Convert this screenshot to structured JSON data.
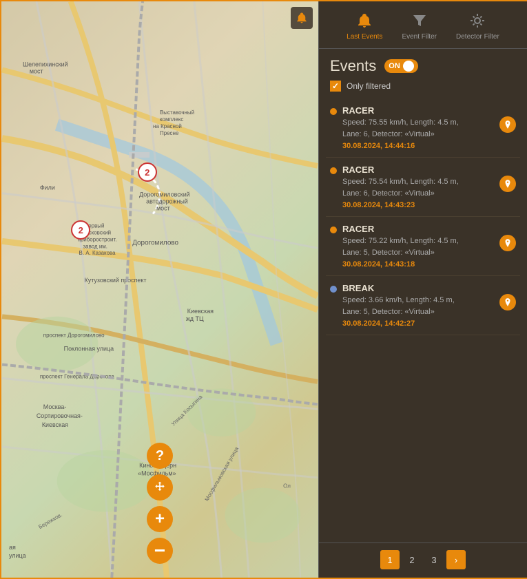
{
  "panel": {
    "tabs": [
      {
        "id": "last-events",
        "label": "Last\nEvents",
        "icon": "bell",
        "active": true
      },
      {
        "id": "event-filter",
        "label": "Event\nFilter",
        "icon": "filter",
        "active": false
      },
      {
        "id": "detector-filter",
        "label": "Detector\nFilter",
        "icon": "detector",
        "active": false
      }
    ],
    "events_title": "Events",
    "toggle_state": "ON",
    "only_filtered_label": "Only filtered",
    "events": [
      {
        "type": "RACER",
        "dot": "orange",
        "details_line1": "Speed: 75.55 km/h, Length: 4.5 m,",
        "details_line2": "Lane: 6, Detector: «Virtual»",
        "timestamp": "30.08.2024, 14:44:16"
      },
      {
        "type": "RACER",
        "dot": "orange",
        "details_line1": "Speed: 75.54 km/h, Length: 4.5 m,",
        "details_line2": "Lane: 6, Detector: «Virtual»",
        "timestamp": "30.08.2024, 14:43:23"
      },
      {
        "type": "RACER",
        "dot": "orange",
        "details_line1": "Speed: 75.22 km/h, Length: 4.5 m,",
        "details_line2": "Lane: 5, Detector: «Virtual»",
        "timestamp": "30.08.2024, 14:43:18"
      },
      {
        "type": "BREAK",
        "dot": "blue",
        "details_line1": "Speed: 3.66 km/h, Length: 4.5 m,",
        "details_line2": "Lane: 5, Detector: «Virtual»",
        "timestamp": "30.08.2024, 14:42:27"
      }
    ],
    "pagination": {
      "pages": [
        "1",
        "2",
        "3"
      ],
      "active_page": "1",
      "next_label": "›"
    }
  },
  "map": {
    "markers": [
      {
        "label": "2",
        "position": "top"
      },
      {
        "label": "2",
        "position": "left"
      }
    ],
    "controls": {
      "help_label": "?",
      "move_label": "⤢",
      "zoom_in_label": "+",
      "zoom_out_label": "−"
    },
    "bell_label": "🔔"
  }
}
